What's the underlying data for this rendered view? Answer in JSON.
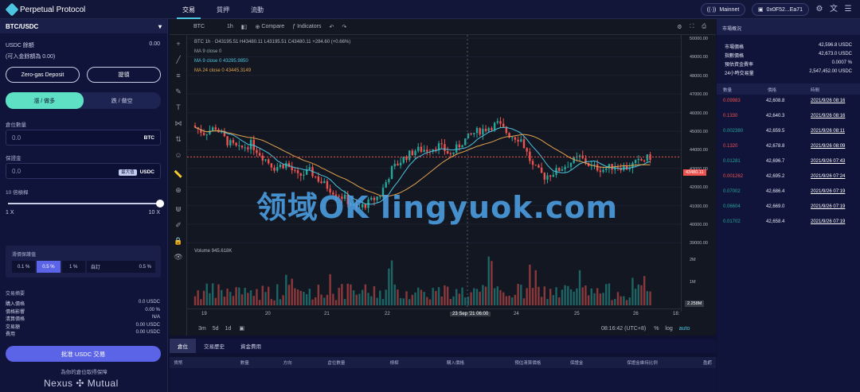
{
  "app": {
    "name": "Perpetual Protocol"
  },
  "nav": {
    "items": [
      "交易",
      "質押",
      "流動"
    ]
  },
  "header": {
    "network": "Mainnet",
    "wallet": "0x0F52...Ea71"
  },
  "colors": {
    "accent": "#4dc5e0",
    "up": "#26a69a",
    "down": "#ef5350",
    "approve": "#5b63e6",
    "toggle": "#5ee0c4"
  },
  "left": {
    "pair": "BTC/USDC",
    "balance_label": "USDC 餘額",
    "balance_value": "0.00",
    "withdrawable": "(可入金餘額為 0.00)",
    "zero_gas_button": "Zero-gas Deposit",
    "withdraw_button": "提領",
    "long_label": "漲 / 做多",
    "short_label": "跌 / 做空",
    "position_label": "倉位數量",
    "position_value": "0.0",
    "position_unit": "BTC",
    "margin_label": "保證金",
    "margin_value": "0.0",
    "margin_max": "最大值",
    "margin_unit": "USDC",
    "leverage_label": "10 倍槓桿",
    "leverage_min": "1 X",
    "leverage_max": "10 X",
    "leverage_fraction": 1.0,
    "slippage_label": "滑價保護值",
    "slippage_options": [
      "0.1 %",
      "0.5 %",
      "1 %"
    ],
    "slippage_custom_label": "自訂",
    "slippage_custom_value": "0.5",
    "slippage_custom_unit": "%",
    "summary_title": "交易摘要",
    "summary": [
      {
        "k": "購入價格",
        "v": "0.0 USDC"
      },
      {
        "k": "價格影響",
        "v": "0.00 %"
      },
      {
        "k": "清算價格",
        "v": "N/A"
      },
      {
        "k": "交易額",
        "v": "0.00 USDC"
      },
      {
        "k": "費用",
        "v": "0.00 USDC"
      }
    ],
    "approve_button": "批准 USDC 交易",
    "protected_text": "為你的倉位取得保障",
    "nexus": "Nexus ✣ Mutual"
  },
  "chart_toolbar": {
    "symbol": "BTC",
    "interval": "1h",
    "compare": "Compare",
    "indicators": "Indicators"
  },
  "chart_legend": {
    "ohlc": "BTC  1h  · O43195.51 H43480.11 L43195.51 C43480.11 +284.60 (+0.66%)",
    "ma1": "MA 9 close 0",
    "ma2": "MA 9 close 0  43295.9850",
    "ma3": "MA 24 close 0  43445.3149",
    "volume": "Volume  945.618K"
  },
  "chart_data": {
    "type": "candlestick",
    "symbol": "BTC",
    "interval": "1h",
    "y_ticks": [
      "50000.00",
      "49000.00",
      "48000.00",
      "47000.00",
      "46000.00",
      "45000.00",
      "44000.00",
      "43000.00",
      "42000.00",
      "41000.00",
      "40000.00",
      "39000.00"
    ],
    "last_price": "43480.11",
    "x_ticks": [
      "19",
      "20",
      "21",
      "22",
      "23 Sep '21  06:00",
      "24",
      "25",
      "26",
      "18:"
    ],
    "volume_ticks": [
      "2M",
      "1M"
    ],
    "volume_last": "2.258M",
    "ylim": [
      39000,
      50000
    ],
    "close_series": [
      45200,
      44800,
      45100,
      44300,
      43900,
      44200,
      43500,
      42900,
      43100,
      42400,
      42700,
      42100,
      41600,
      41200,
      40600,
      40950,
      41400,
      42800,
      43400,
      43850,
      43900,
      44100,
      43600,
      44300,
      44800,
      45050,
      45300,
      44700,
      44450,
      42950,
      42400,
      42700,
      43100,
      43450,
      42950,
      42800,
      43000,
      42900,
      43200,
      43480
    ]
  },
  "chart_bottom": {
    "ranges": [
      "3m",
      "5d",
      "1d"
    ],
    "time": "08:16:42 (UTC+8)",
    "scale": [
      "%",
      "log",
      "auto"
    ]
  },
  "watermark": "领域OK lingyuok.com",
  "right": {
    "market_title": "市場概況",
    "stats": [
      {
        "k": "市場價格",
        "v": "42,596.8 USDC"
      },
      {
        "k": "指數價格",
        "v": "42,673.0 USDC"
      },
      {
        "k": "預估資金費率",
        "v": "0.0007 %"
      },
      {
        "k": "24小時交易量",
        "v": "2,547,452.00 USDC"
      }
    ],
    "cols": [
      "數量",
      "價格",
      "時間"
    ],
    "trades": [
      {
        "qty": "0.09983",
        "price": "42,608.8",
        "time": "2021/9/26 08:16",
        "side": "sell"
      },
      {
        "qty": "0.1330",
        "price": "42,640.3",
        "time": "2021/9/26 08:16",
        "side": "sell"
      },
      {
        "qty": "0.002380",
        "price": "42,659.5",
        "time": "2021/9/26 08:11",
        "side": "buy"
      },
      {
        "qty": "0.1320",
        "price": "42,678.8",
        "time": "2021/9/26 08:09",
        "side": "sell"
      },
      {
        "qty": "0.01281",
        "price": "42,696.7",
        "time": "2021/9/26 07:43",
        "side": "buy"
      },
      {
        "qty": "0.001262",
        "price": "42,695.2",
        "time": "2021/9/26 07:24",
        "side": "sell"
      },
      {
        "qty": "0.07002",
        "price": "42,686.4",
        "time": "2021/9/26 07:19",
        "side": "buy"
      },
      {
        "qty": "0.06604",
        "price": "42,669.0",
        "time": "2021/9/26 07:19",
        "side": "buy"
      },
      {
        "qty": "0.01702",
        "price": "42,658.4",
        "time": "2021/9/26 07:19",
        "side": "buy"
      }
    ]
  },
  "bottom": {
    "tabs": [
      "倉位",
      "交易歷史",
      "資金費用"
    ],
    "cols": [
      "貨幣",
      "數量",
      "方向",
      "倉位數量",
      "槓桿",
      "購入價格",
      "預估清算價格",
      "保證金",
      "保證金維持比例",
      "盈虧"
    ]
  }
}
